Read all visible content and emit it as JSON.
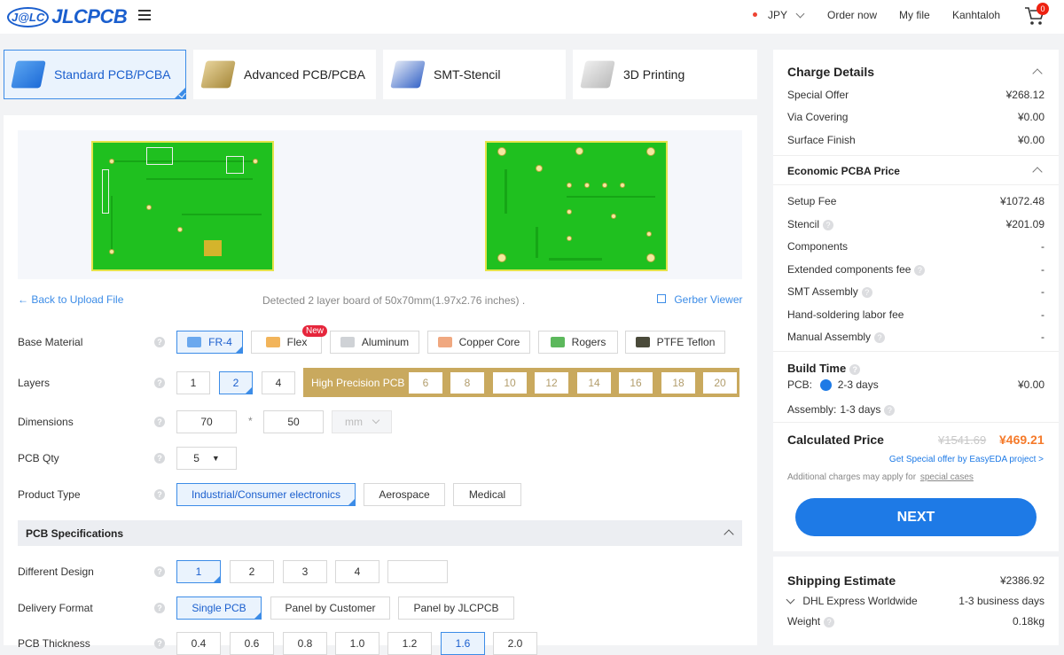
{
  "header": {
    "logo_badge": "J@LC",
    "logo_text": "JLCPCB",
    "currency": "JPY",
    "order_now": "Order now",
    "my_file": "My file",
    "username": "Kanhtaloh",
    "cart_count": "0"
  },
  "tabs": [
    {
      "label": "Standard PCB/PCBA"
    },
    {
      "label": "Advanced PCB/PCBA"
    },
    {
      "label": "SMT-Stencil"
    },
    {
      "label": "3D Printing"
    }
  ],
  "upload": {
    "back": "Back to Upload File",
    "detected": "Detected 2 layer board of 50x70mm(1.97x2.76 inches) .",
    "gerber": "Gerber Viewer"
  },
  "form": {
    "base_material_label": "Base Material",
    "materials": [
      "FR-4",
      "Flex",
      "Aluminum",
      "Copper Core",
      "Rogers",
      "PTFE Teflon"
    ],
    "new_badge": "New",
    "layers_label": "Layers",
    "layers": [
      "1",
      "2",
      "4"
    ],
    "hp_label": "High Precision PCB",
    "hp_layers": [
      "6",
      "8",
      "10",
      "12",
      "14",
      "16",
      "18",
      "20"
    ],
    "dimensions_label": "Dimensions",
    "dim_x": "70",
    "dim_y": "50",
    "dim_sep": "*",
    "dim_unit": "mm",
    "qty_label": "PCB Qty",
    "qty": "5",
    "product_type_label": "Product Type",
    "product_types": [
      "Industrial/Consumer electronics",
      "Aerospace",
      "Medical"
    ],
    "spec_header": "PCB Specifications",
    "design_label": "Different Design",
    "designs": [
      "1",
      "2",
      "3",
      "4"
    ],
    "delivery_label": "Delivery Format",
    "deliveries": [
      "Single PCB",
      "Panel by Customer",
      "Panel by JLCPCB"
    ],
    "thickness_label": "PCB Thickness",
    "thicknesses": [
      "0.4",
      "0.6",
      "0.8",
      "1.0",
      "1.2",
      "1.6",
      "2.0"
    ]
  },
  "charges": {
    "title": "Charge Details",
    "special_offer": "Special Offer",
    "special_offer_val": "¥268.12",
    "via_covering": "Via Covering",
    "via_covering_val": "¥0.00",
    "surface_finish": "Surface Finish",
    "surface_finish_val": "¥0.00",
    "pcba_title": "Economic PCBA Price",
    "setup_fee": "Setup Fee",
    "setup_fee_val": "¥1072.48",
    "stencil": "Stencil",
    "stencil_val": "¥201.09",
    "components": "Components",
    "components_val": "-",
    "extended": "Extended components fee",
    "extended_val": "-",
    "smt": "SMT Assembly",
    "smt_val": "-",
    "hand": "Hand-soldering labor fee",
    "hand_val": "-",
    "manual": "Manual Assembly",
    "manual_val": "-",
    "build_title": "Build Time",
    "pcb_label": "PCB:",
    "pcb_time": "2-3 days",
    "pcb_time_val": "¥0.00",
    "assembly_label": "Assembly:",
    "assembly_time": "1-3 days",
    "calc_label": "Calculated Price",
    "old_price": "¥1541.69",
    "new_price": "¥469.21",
    "special_link": "Get Special offer by EasyEDA project >",
    "additional": "Additional charges may apply for",
    "special_cases": "special cases",
    "next": "NEXT"
  },
  "shipping": {
    "title": "Shipping Estimate",
    "price": "¥2386.92",
    "carrier": "DHL Express Worldwide",
    "days": "1-3 business days",
    "weight_label": "Weight",
    "weight": "0.18kg"
  }
}
